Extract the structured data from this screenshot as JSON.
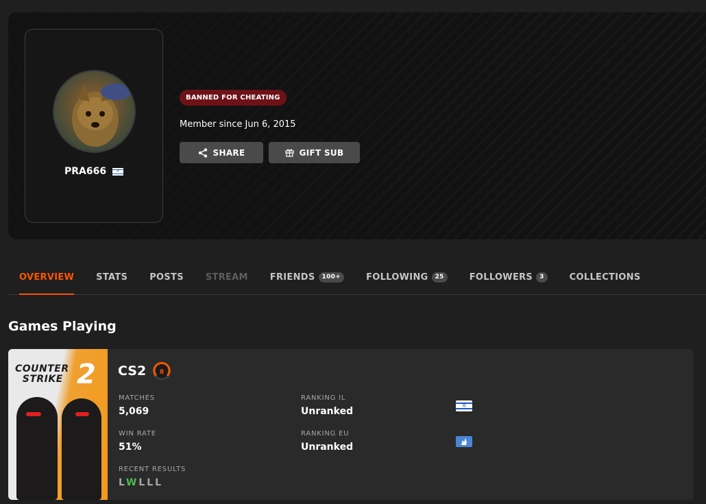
{
  "profile": {
    "username": "PRA666",
    "ban_badge": "BANNED FOR CHEATING",
    "member_since": "Member since Jun 6, 2015",
    "share_label": "SHARE",
    "gift_label": "GIFT SUB"
  },
  "tabs": [
    {
      "label": "OVERVIEW",
      "state": "active"
    },
    {
      "label": "STATS"
    },
    {
      "label": "POSTS"
    },
    {
      "label": "STREAM",
      "state": "disabled"
    },
    {
      "label": "FRIENDS",
      "count": "100+"
    },
    {
      "label": "FOLLOWING",
      "count": "25"
    },
    {
      "label": "FOLLOWERS",
      "count": "3"
    },
    {
      "label": "COLLECTIONS"
    }
  ],
  "games_section": {
    "title": "Games Playing",
    "game": {
      "cover_line1": "COUNTER",
      "cover_line2": "STRIKE",
      "cover_number": "2",
      "name": "CS2",
      "level": "8",
      "matches_label": "MATCHES",
      "matches_value": "5,069",
      "win_rate_label": "WIN RATE",
      "win_rate_value": "51%",
      "ranking_il_label": "RANKING IL",
      "ranking_il_value": "Unranked",
      "ranking_eu_label": "RANKING EU",
      "ranking_eu_value": "Unranked",
      "recent_results_label": "RECENT RESULTS",
      "recent_results": [
        "L",
        "W",
        "L",
        "L",
        "L"
      ]
    }
  },
  "colors": {
    "accent": "#ff5500",
    "ban_badge_bg": "#6e1218",
    "win": "#4bbd4b",
    "loss": "#a8a8a8"
  }
}
